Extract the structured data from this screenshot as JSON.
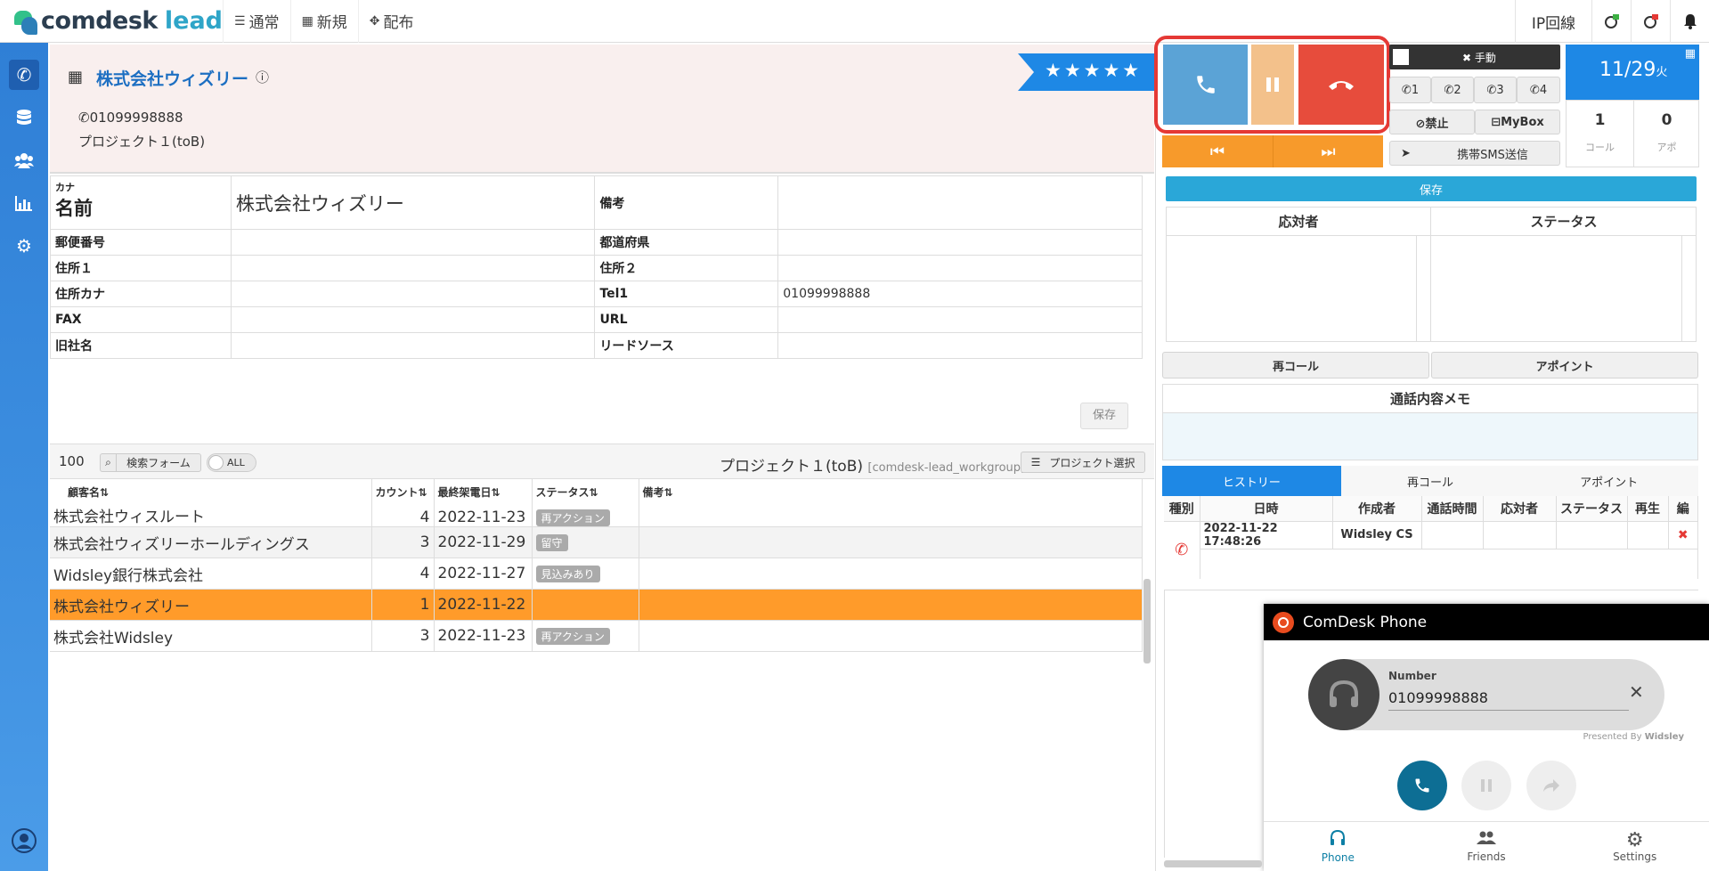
{
  "app": {
    "logo_main": "comdesk",
    "logo_sub": "lead",
    "nav": [
      {
        "icon": "☰",
        "label": "通常"
      },
      {
        "icon": "▦",
        "label": "新規"
      },
      {
        "icon": "✥",
        "label": "配布"
      }
    ],
    "ip_line": "IP回線"
  },
  "company": {
    "name": "株式会社ウィズリー",
    "phone": "01099998888",
    "project": "プロジェクト１(toB)",
    "rating_stars": "★★★★★"
  },
  "detail": {
    "kana_label": "カナ",
    "name_label": "名前",
    "name_value": "株式会社ウィズリー",
    "note_label": "備考",
    "rows": [
      {
        "l1": "郵便番号",
        "v1": "",
        "l2": "都道府県",
        "v2": ""
      },
      {
        "l1": "住所１",
        "v1": "",
        "l2": "住所２",
        "v2": ""
      },
      {
        "l1": "住所カナ",
        "v1": "",
        "l2": "Tel1",
        "v2": "01099998888"
      },
      {
        "l1": "FAX",
        "v1": "",
        "l2": "URL",
        "v2": ""
      },
      {
        "l1": "旧社名",
        "v1": "",
        "l2": "リードソース",
        "v2": ""
      }
    ],
    "save_label": "保存"
  },
  "list": {
    "count": "100",
    "search_form_label": "検索フォーム",
    "all_label": "ALL",
    "project_title": "プロジェクト１(toB)",
    "workgroup": "[comdesk-lead_workgroup]",
    "project_select_label": "プロジェクト選択",
    "headers": [
      "顧客名⇅",
      "カウント⇅",
      "最終架電日⇅",
      "ステータス⇅",
      "備考⇅"
    ],
    "rows": [
      {
        "name": "株式会社ウィスルート",
        "count": "4",
        "date": "2022-11-23",
        "status": "再アクション",
        "note": ""
      },
      {
        "name": "株式会社ウィズリーホールディングス",
        "count": "3",
        "date": "2022-11-29",
        "status": "留守",
        "note": ""
      },
      {
        "name": "Widsley銀行株式会社",
        "count": "4",
        "date": "2022-11-27",
        "status": "見込みあり",
        "note": ""
      },
      {
        "name": "株式会社ウィズリー",
        "count": "1",
        "date": "2022-11-22",
        "status": "",
        "note": ""
      },
      {
        "name": "株式会社Widsley",
        "count": "3",
        "date": "2022-11-23",
        "status": "再アクション",
        "note": ""
      }
    ]
  },
  "right": {
    "manual_label": "✖ 手動",
    "lines": [
      "1",
      "2",
      "3",
      "4"
    ],
    "ban_label": "⊘禁止",
    "mybox_label": "MyBox",
    "sms_label": "携帯SMS送信",
    "date": "11/29",
    "weekday": "火",
    "call_count": "1",
    "call_label": "コール",
    "appo_count": "0",
    "appo_label": "アポ",
    "save_label": "保存",
    "responder_label": "応対者",
    "status_label": "ステータス",
    "recall_label": "再コール",
    "appoint_label": "アポイント",
    "memo_label": "通話内容メモ",
    "hist_tabs": [
      "ヒストリー",
      "再コール",
      "アポイント"
    ],
    "hist_headers": [
      "種別",
      "日時",
      "作成者",
      "通話時間",
      "応対者",
      "ステータス",
      "再生",
      "編"
    ],
    "hist_rows": [
      {
        "datetime": "2022-11-22 17:48:26",
        "creator": "Widsley CS"
      }
    ]
  },
  "widget": {
    "title": "ComDesk Phone",
    "number_label": "Number",
    "number_value": "01099998888",
    "presented_by": "Presented By",
    "presented_brand": "Widsley",
    "tabs": [
      "Phone",
      "Friends",
      "Settings"
    ]
  },
  "colors": {
    "accent_blue": "#1e88e5",
    "call_blue": "#5ba3d6",
    "hold_orange": "#f3c18b",
    "hangup_red": "#e74c3c",
    "selected_row": "#ff9b2a",
    "widget_call": "#0d6e94"
  }
}
